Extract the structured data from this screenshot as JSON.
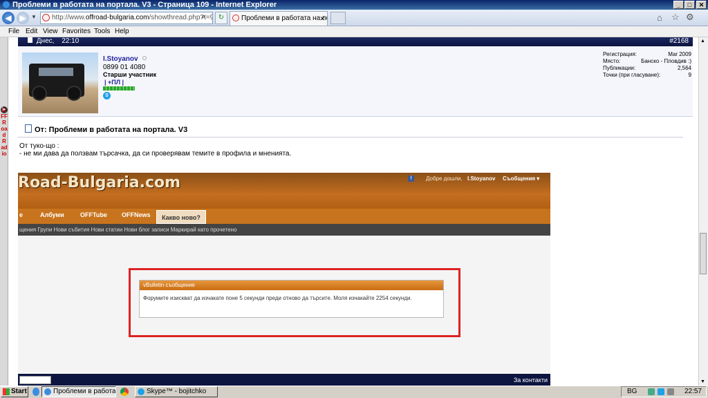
{
  "window": {
    "title": "Проблеми в работата на портала. V3 - Страница 109 - Internet Explorer"
  },
  "browser": {
    "url_prefix": "http://www.",
    "url_domain": "offroad-bulgaria.com",
    "url_rest": "/showthread.php?t=95",
    "tab_label": "Проблеми в работата на по...",
    "menu": [
      "File",
      "Edit",
      "View",
      "Favorites",
      "Tools",
      "Help"
    ]
  },
  "sidebar": {
    "radio_label": "OFFRoadRadio"
  },
  "post": {
    "date_label": "Днес,",
    "time": "22:10",
    "number": "#2168",
    "username": "I.Stoyanov",
    "phone": "0899 01 4080",
    "rank": "Старши участник",
    "badge": "| +ПЛ |",
    "stats": [
      {
        "label": "Регистрация:",
        "value": "Mar 2009"
      },
      {
        "label": "Място:",
        "value": "Банско - Пловдив :)"
      },
      {
        "label": "Публикации:",
        "value": "2,564"
      },
      {
        "label": "Точки (при гласуване):",
        "value": "9"
      }
    ],
    "title": "От: Проблеми в работата на портала. V3",
    "body_line1": "От туко-що :",
    "body_line2": "- не ми дава да ползвам търсачка, да си проверявам темите в профила и мненията."
  },
  "screenshot": {
    "logo": "Road-Bulgaria.com",
    "welcome": "Добре дошли,",
    "user": "I.Stoyanov",
    "messages": "Съобщения ▾",
    "nav": [
      "e",
      "Албуми",
      "OFFTube",
      "OFFNews"
    ],
    "nav_active": "Какво ново?",
    "subnav": "щения Групи   Нови събития   Нови статии   Нови блог записи   Маркирай като прочетено",
    "dialog_title": "vBulletin съобщение",
    "dialog_text": "Форумите изискват да изчакате поне 5 секунди преди отново да търсите. Моля изчакайте 2254 секунди."
  },
  "footer": {
    "contacts": "За контакти"
  },
  "taskbar": {
    "start": "Start",
    "items": [
      {
        "label": "Проблеми в работат...",
        "active": true
      },
      {
        "label": "Skype™ - bojitchko",
        "active": false
      }
    ],
    "lang": "BG",
    "clock": "22:57"
  },
  "colors": {
    "title_bar": "#0a246a",
    "post_header": "#0c1440",
    "orange": "#c8741e",
    "highlight_box": "#dd2222"
  }
}
